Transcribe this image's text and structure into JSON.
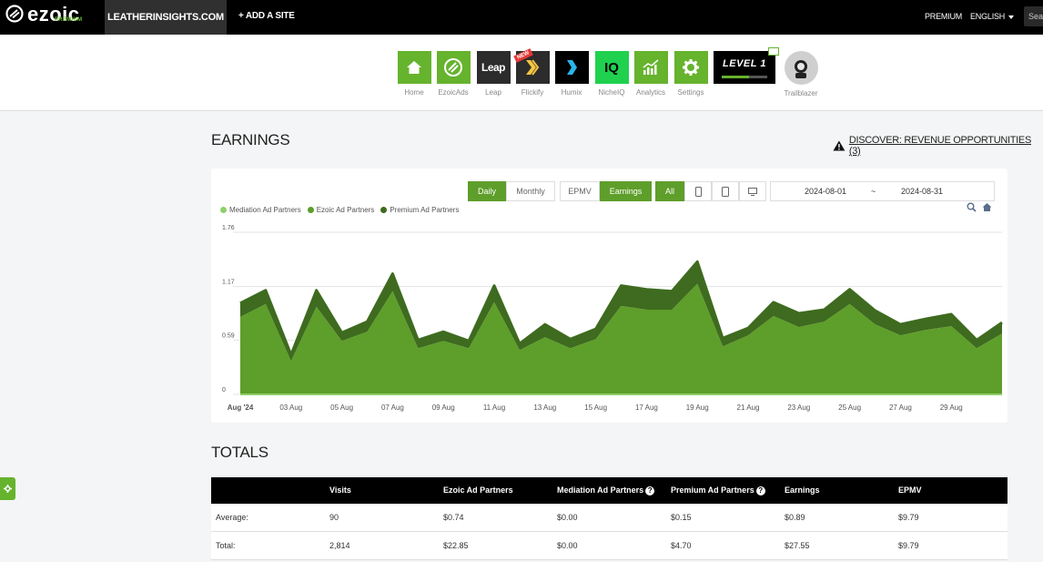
{
  "topbar": {
    "logo": "ezoic",
    "logo_sub": "PREMIUM",
    "site": "LEATHERINSIGHTS.COM",
    "add_site": "+ ADD A SITE",
    "premium": "PREMIUM",
    "language": "ENGLISH",
    "search": "Sea"
  },
  "nav": {
    "items": [
      {
        "label": "Home",
        "icon": "home-icon"
      },
      {
        "label": "EzoicAds",
        "icon": "ezoicads-icon"
      },
      {
        "label": "Leap",
        "icon": "leap-icon",
        "tile_text": "Leap"
      },
      {
        "label": "Flickify",
        "icon": "flickify-icon",
        "badge": "NEW"
      },
      {
        "label": "Humix",
        "icon": "humix-icon"
      },
      {
        "label": "NicheIQ",
        "icon": "nicheiq-icon",
        "tile_text": "IQ"
      },
      {
        "label": "Analytics",
        "icon": "analytics-icon"
      },
      {
        "label": "Settings",
        "icon": "gear-icon"
      }
    ],
    "level": "LEVEL 1",
    "level_progress": 0.6,
    "trailblazer": "Trailblazer"
  },
  "earnings": {
    "title": "EARNINGS",
    "discover": "DISCOVER: REVENUE OPPORTUNITIES (3)",
    "buttons": {
      "daily": "Daily",
      "monthly": "Monthly",
      "epmv": "EPMV",
      "earnings": "Earnings",
      "all": "All"
    },
    "date_start": "2024-08-01",
    "date_sep": "~",
    "date_end": "2024-08-31"
  },
  "chart_data": {
    "type": "area",
    "legend": [
      "Mediation Ad Partners",
      "Ezoic Ad Partners",
      "Premium Ad Partners"
    ],
    "colors": {
      "mediation": "#8fcf6a",
      "ezoic": "#5e9e2a",
      "premium": "#3e6b1f"
    },
    "y_ticks": [
      "0",
      "0.59",
      "1.17",
      "1.76"
    ],
    "ylim": [
      0,
      1.76
    ],
    "x_labels": [
      "Aug '24",
      "03 Aug",
      "05 Aug",
      "07 Aug",
      "09 Aug",
      "11 Aug",
      "13 Aug",
      "15 Aug",
      "17 Aug",
      "19 Aug",
      "21 Aug",
      "23 Aug",
      "25 Aug",
      "27 Aug",
      "29 Aug"
    ],
    "days": [
      1,
      2,
      3,
      4,
      5,
      6,
      7,
      8,
      9,
      10,
      11,
      12,
      13,
      14,
      15,
      16,
      17,
      18,
      19,
      20,
      21,
      22,
      23,
      24,
      25,
      26,
      27,
      28,
      29,
      30,
      31
    ],
    "series": [
      {
        "name": "Mediation Ad Partners",
        "values": [
          0,
          0,
          0,
          0,
          0,
          0,
          0,
          0,
          0,
          0,
          0,
          0,
          0,
          0,
          0,
          0,
          0,
          0,
          0,
          0,
          0,
          0,
          0,
          0,
          0,
          0,
          0,
          0,
          0,
          0,
          0
        ]
      },
      {
        "name": "Ezoic Ad Partners",
        "values": [
          0.84,
          0.98,
          0.36,
          0.95,
          0.58,
          0.68,
          1.12,
          0.5,
          0.58,
          0.5,
          1.0,
          0.48,
          0.62,
          0.5,
          0.6,
          0.96,
          0.92,
          0.92,
          1.2,
          0.52,
          0.64,
          0.85,
          0.73,
          0.79,
          0.98,
          0.76,
          0.64,
          0.7,
          0.74,
          0.5,
          0.66
        ]
      },
      {
        "name": "Premium Ad Partners",
        "values": [
          0.15,
          0.15,
          0.07,
          0.18,
          0.09,
          0.11,
          0.19,
          0.09,
          0.1,
          0.08,
          0.18,
          0.07,
          0.14,
          0.1,
          0.11,
          0.22,
          0.22,
          0.2,
          0.24,
          0.09,
          0.08,
          0.15,
          0.15,
          0.13,
          0.16,
          0.15,
          0.12,
          0.12,
          0.13,
          0.09,
          0.12
        ]
      }
    ]
  },
  "totals": {
    "title": "TOTALS",
    "headers": [
      "",
      "Visits",
      "Ezoic Ad Partners",
      "Mediation Ad Partners",
      "Premium Ad Partners",
      "Earnings",
      "EPMV"
    ],
    "rows": [
      [
        "Average:",
        "90",
        "$0.74",
        "$0.00",
        "$0.15",
        "$0.89",
        "$9.79"
      ],
      [
        "Total:",
        "2,814",
        "$22.85",
        "$0.00",
        "$4.70",
        "$27.55",
        "$9.79"
      ]
    ]
  }
}
